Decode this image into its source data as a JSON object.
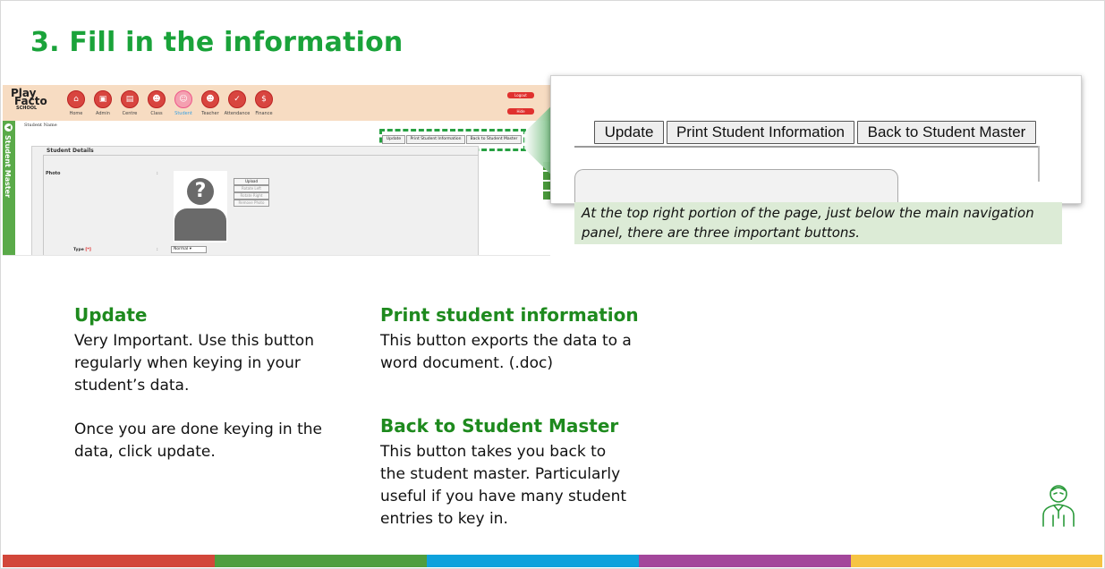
{
  "slide": {
    "title": "3. Fill in the information",
    "caption": "At the top right portion of the page, just below the main navigation panel, there are three important buttons."
  },
  "app": {
    "logo": {
      "line1": "Play",
      "line2": "Facto",
      "line3": "SCHOOL"
    },
    "nav": [
      "Home",
      "Admin",
      "Centre",
      "Class",
      "Student",
      "Teacher",
      "Attendance",
      "Finance"
    ],
    "active_nav": "Student",
    "logout_label": "Logout",
    "hide_label": "Hide",
    "sidebar_label": "Student Master",
    "student_name_label": "Student Name",
    "buttons": {
      "update": "Update",
      "print": "Print Student Information",
      "back": "Back to Student Master"
    },
    "panel_title": "Student Details",
    "photo_label": "Photo",
    "photo_buttons": [
      "Upload",
      "Rotate Left",
      "Rotate Right",
      "Remove Photo"
    ],
    "type_label": "Type",
    "type_required": "[*]",
    "colon": ":",
    "type_value": "Normal"
  },
  "zoom": {
    "update": "Update",
    "print": "Print Student Information",
    "back": "Back to Student Master"
  },
  "sections": {
    "update": {
      "title": "Update",
      "p1": [
        "Very Important. Use this button",
        "regularly when keying in your",
        "student’s data."
      ],
      "p2": [
        "Once you are done keying in the",
        "data, click update."
      ]
    },
    "print": {
      "title": "Print student information",
      "p1": [
        "This button exports the data to a",
        "word document. (.doc)"
      ]
    },
    "back": {
      "title": "Back to Student Master",
      "p1": [
        "This button takes you back to",
        "the student master. Particularly",
        "useful if you have many student",
        "entries to key in."
      ]
    }
  },
  "colors": {
    "title_green": "#1aa33a",
    "heading_green": "#1e8a1e",
    "bar": [
      "#d2473a",
      "#4e9e3f",
      "#0ea2dc",
      "#a3479b",
      "#f6c443"
    ]
  }
}
